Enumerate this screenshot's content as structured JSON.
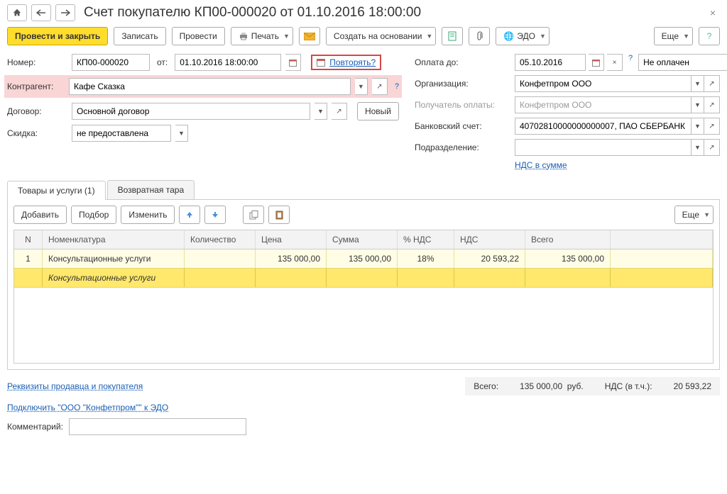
{
  "title": "Счет покупателю КП00-000020 от 01.10.2016 18:00:00",
  "toolbar": {
    "post_close": "Провести и закрыть",
    "write": "Записать",
    "post": "Провести",
    "print": "Печать",
    "create_based": "Создать на основании",
    "edo": "ЭДО",
    "more": "Еще"
  },
  "labels": {
    "number": "Номер:",
    "from": "от:",
    "repeat": "Повторять?",
    "counterparty": "Контрагент:",
    "contract": "Договор:",
    "new": "Новый",
    "discount": "Скидка:",
    "pay_until": "Оплата до:",
    "status_unpaid": "Не оплачен",
    "organization": "Организация:",
    "payee": "Получатель оплаты:",
    "bank_acct": "Банковский счет:",
    "subdiv": "Подразделение:",
    "vat_in_sum": "НДС в сумме",
    "comment": "Комментарий:"
  },
  "values": {
    "number": "КП00-000020",
    "date": "01.10.2016 18:00:00",
    "counterparty": "Кафе Сказка",
    "contract": "Основной договор",
    "discount": "не предоставлена",
    "pay_until": "05.10.2016",
    "organization": "Конфетпром ООО",
    "payee": "Конфетпром ООО",
    "bank_acct": "40702810000000000007, ПАО СБЕРБАНК",
    "subdiv": ""
  },
  "tabs": {
    "goods": "Товары и услуги (1)",
    "returnable": "Возвратная тара"
  },
  "grid_toolbar": {
    "add": "Добавить",
    "pick": "Подбор",
    "edit": "Изменить",
    "more": "Еще"
  },
  "grid": {
    "head": {
      "n": "N",
      "nomen": "Номенклатура",
      "qty": "Количество",
      "price": "Цена",
      "sum": "Сумма",
      "vat_pct": "% НДС",
      "vat": "НДС",
      "total": "Всего"
    },
    "rows": [
      {
        "n": "1",
        "nomen": "Консультационные услуги",
        "qty": "",
        "price": "135 000,00",
        "sum": "135 000,00",
        "vat_pct": "18%",
        "vat": "20 593,22",
        "total": "135 000,00",
        "sub": "Консультационные услуги"
      }
    ]
  },
  "totals": {
    "total_lbl": "Всего:",
    "total_val": "135 000,00",
    "cur": "руб.",
    "vat_lbl": "НДС (в т.ч.):",
    "vat_val": "20 593,22"
  },
  "links": {
    "seller_buyer": "Реквизиты продавца и покупателя",
    "edo_connect": "Подключить \"ООО \"Конфетпром\"\" к ЭДО"
  }
}
